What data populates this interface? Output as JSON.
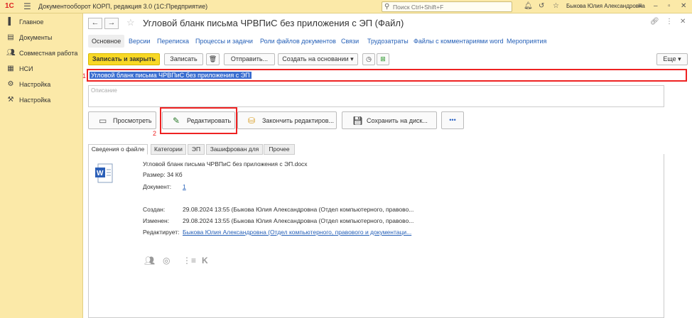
{
  "titlebar": {
    "logo": "1С",
    "title": "Документооборот КОРП, редакция 3.0  (1С:Предприятие)",
    "search_placeholder": "Поиск Ctrl+Shift+F",
    "user": "Быкова Юлия Александровна"
  },
  "sidebar": {
    "items": [
      {
        "label": "Главное",
        "icon": "home-icon"
      },
      {
        "label": "Документы",
        "icon": "documents-icon"
      },
      {
        "label": "Совместная работа",
        "icon": "team-icon"
      },
      {
        "label": "НСИ",
        "icon": "reference-icon"
      },
      {
        "label": "Настройка",
        "icon": "settings-icon"
      },
      {
        "label": "Настройка",
        "icon": "settings2-icon"
      }
    ]
  },
  "header": {
    "title": "Угловой бланк письма ЧРВПиС без приложения с ЭП (Файл)"
  },
  "tabs": [
    "Основное",
    "Версии",
    "Переписка",
    "Процессы и задачи",
    "Роли файлов документов",
    "Связи",
    "Трудозатраты",
    "Файлы с комментариями word",
    "Мероприятия"
  ],
  "toolbar": {
    "save_close": "Записать и закрыть",
    "save": "Записать",
    "send": "Отправить...",
    "create_based": "Создать на основании",
    "more": "Еще"
  },
  "form": {
    "name_value": "Угловой бланк письма ЧРВПиС без приложения с ЭП",
    "description_placeholder": "Описание",
    "marker1": "1",
    "marker2": "2"
  },
  "actions": {
    "view": "Просмотреть",
    "edit": "Редактировать",
    "finish_edit": "Закончить редактиров...",
    "save_disk": "Сохранить на диск...",
    "dots": "•••"
  },
  "panel_tabs": [
    "Сведения о файле",
    "Категории",
    "ЭП",
    "Зашифрован для",
    "Прочее"
  ],
  "file_info": {
    "filename": "Угловой бланк письма ЧРВПиС без приложения с ЭП.docx",
    "size": "Размер: 34 Кб",
    "doc_label": "Документ:",
    "doc_value": "1",
    "created_label": "Создан:",
    "created_value": "29.08.2024 13:55 (Быкова Юлия Александровна (Отдел компьютерного, правово...",
    "changed_label": "Изменен:",
    "changed_value": "29.08.2024 13:55 (Быкова Юлия Александровна (Отдел компьютерного, правово...",
    "editing_label": "Редактирует:",
    "editing_value": "Быкова Юлия Александровна (Отдел компьютерного, правового и документаци..."
  }
}
